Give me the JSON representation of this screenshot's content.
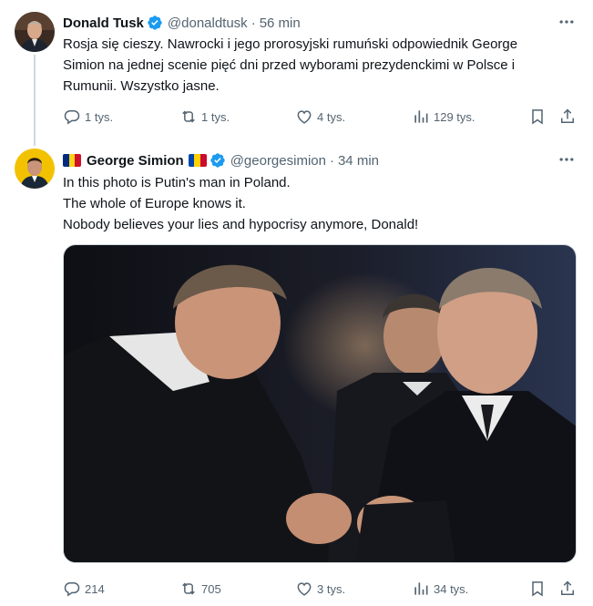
{
  "tweets": [
    {
      "author_name": "Donald Tusk",
      "handle": "@donaldtusk",
      "separator": "·",
      "time": "56 min",
      "text_lines": [
        "Rosja się cieszy. Nawrocki i jego prorosyjski rumuński odpowiednik George",
        "Simion na jednej scenie pięć dni przed wyborami prezydenckimi w Polsce i",
        "Rumunii. Wszystko jasne."
      ],
      "replies": "1 tys.",
      "reposts": "1 tys.",
      "likes": "4 tys.",
      "views": "129 tys."
    },
    {
      "author_name": "George Simion",
      "handle": "@georgesimion",
      "separator": "·",
      "time": "34 min",
      "text_lines": [
        "In this photo is Putin's man in Poland.",
        "The whole of Europe knows it.",
        "Nobody believes your lies and hypocrisy anymore, Donald!"
      ],
      "replies": "214",
      "reposts": "705",
      "likes": "3 tys.",
      "views": "34 tys."
    }
  ],
  "icons": {
    "verified": "verified-badge-icon",
    "more": "more-options-icon",
    "reply": "reply-icon",
    "repost": "repost-icon",
    "like": "like-icon",
    "views": "views-icon",
    "bookmark": "bookmark-icon",
    "share": "share-icon"
  },
  "colors": {
    "text": "#0f1419",
    "secondary": "#536471",
    "verified": "#1d9bf0",
    "thread_line": "#cfd9de"
  }
}
